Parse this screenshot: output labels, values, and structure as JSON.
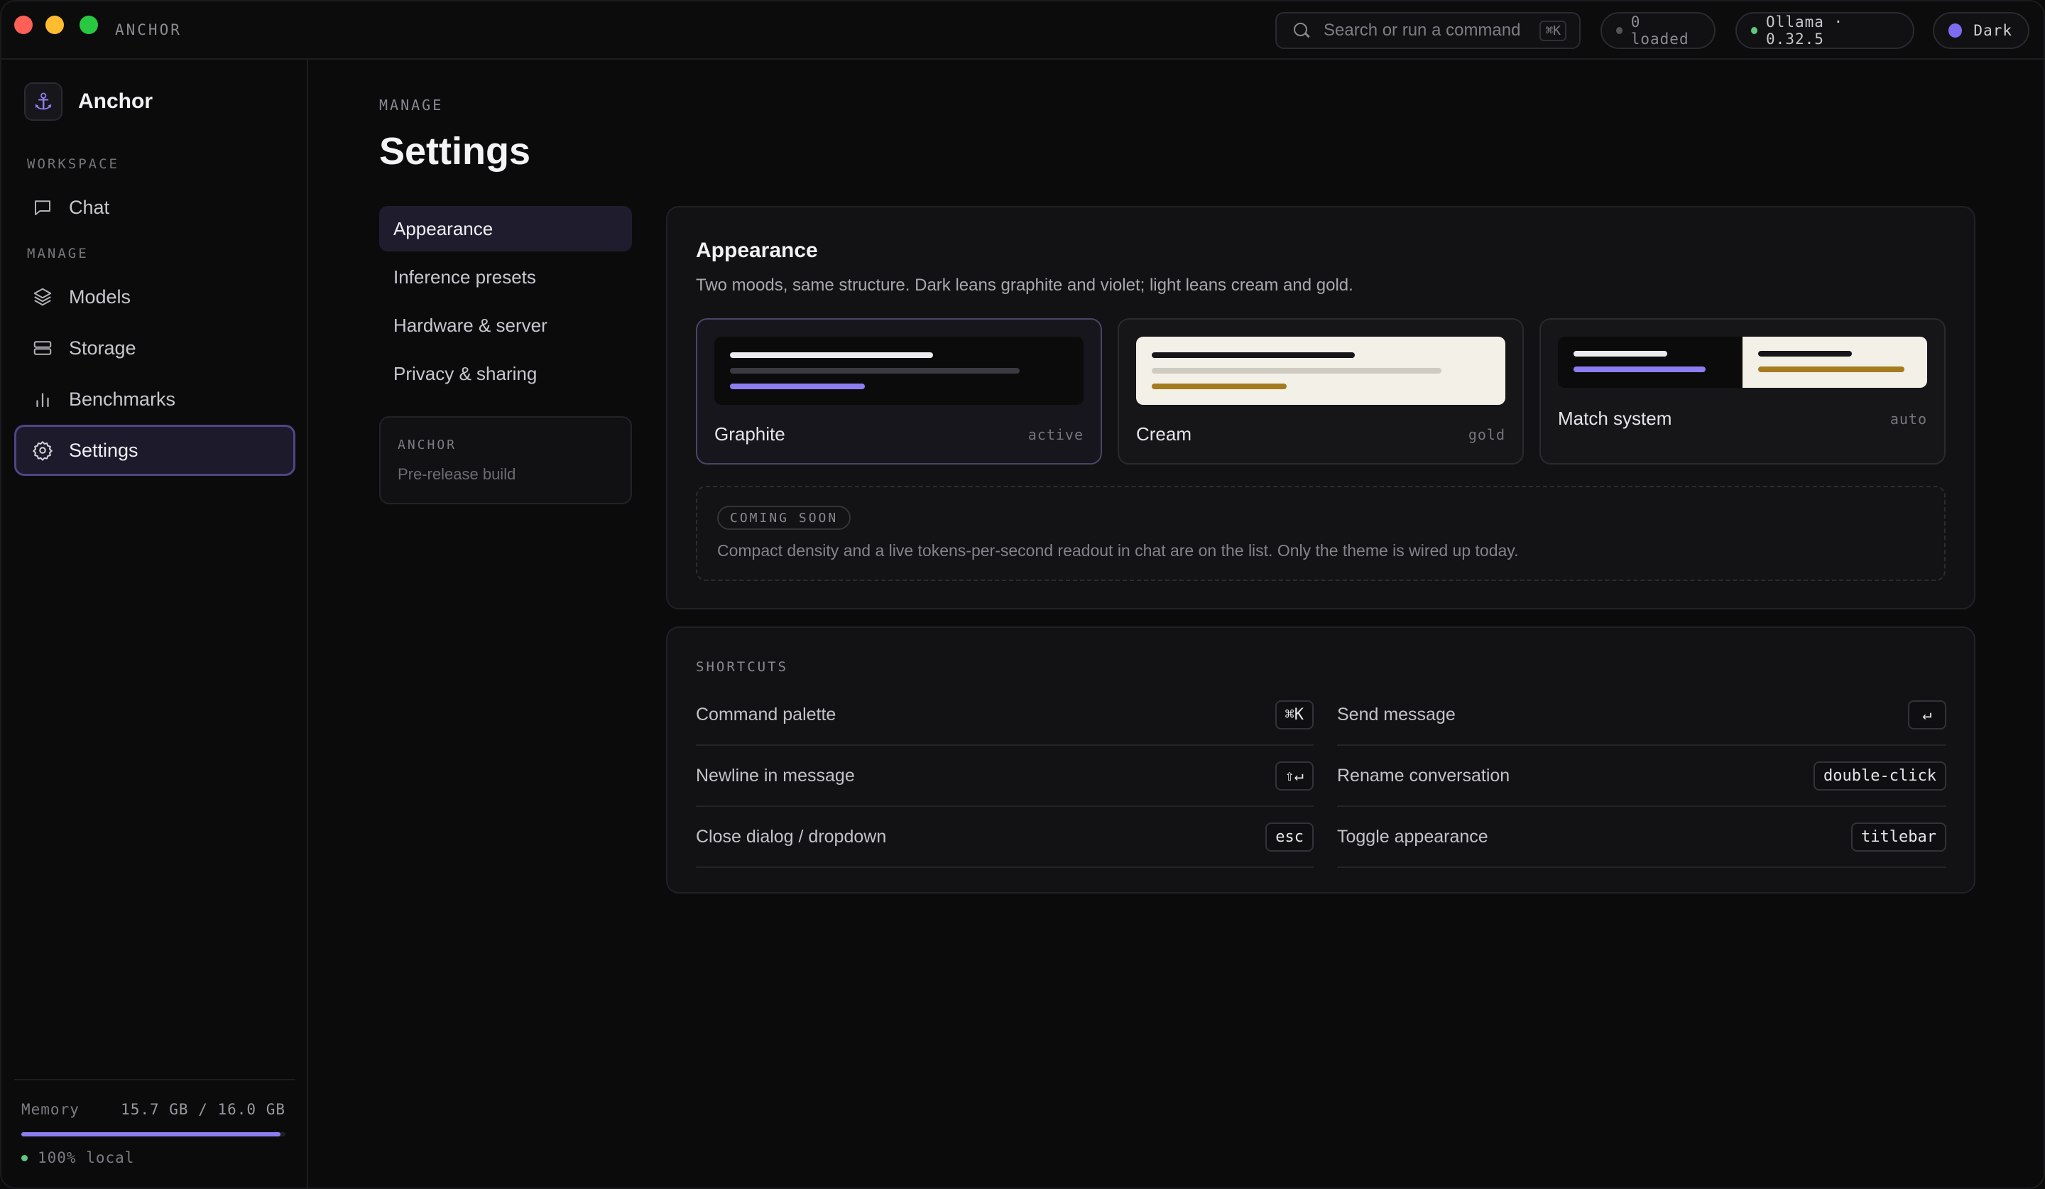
{
  "titlebar": {
    "app_name": "ANCHOR",
    "search": {
      "placeholder": "Search or run a command",
      "shortcut": "⌘K"
    },
    "loaded": "0 loaded",
    "engine": "Ollama · 0.32.5",
    "theme": "Dark"
  },
  "sidebar": {
    "brand": "Anchor",
    "brand_icon": "⚓",
    "sections": {
      "workspace": "WORKSPACE",
      "manage": "MANAGE"
    },
    "items": [
      {
        "label": "Chat",
        "icon": "chat-icon"
      },
      {
        "label": "Models",
        "icon": "layers-icon"
      },
      {
        "label": "Storage",
        "icon": "storage-icon"
      },
      {
        "label": "Benchmarks",
        "icon": "bar-chart-icon"
      },
      {
        "label": "Settings",
        "icon": "gear-icon",
        "active": true
      }
    ],
    "memory": {
      "label": "Memory",
      "value": "15.7 GB / 16.0 GB",
      "fraction": 0.98
    },
    "local": "100% local"
  },
  "main": {
    "breadcrumb": "MANAGE",
    "title": "Settings",
    "subnav": [
      {
        "label": "Appearance",
        "active": true
      },
      {
        "label": "Inference presets"
      },
      {
        "label": "Hardware & server"
      },
      {
        "label": "Privacy & sharing"
      }
    ],
    "build_box": {
      "title": "ANCHOR",
      "subtitle": "Pre-release build"
    },
    "appearance": {
      "title": "Appearance",
      "description": "Two moods, same structure. Dark leans graphite and violet; light leans cream and gold.",
      "themes": [
        {
          "name": "Graphite",
          "tag": "active"
        },
        {
          "name": "Cream",
          "tag": "gold"
        },
        {
          "name": "Match system",
          "tag": "auto"
        }
      ],
      "coming_soon": {
        "badge": "COMING SOON",
        "text": "Compact density and a live tokens-per-second readout in chat are on the list. Only the theme is wired up today."
      }
    },
    "shortcuts": {
      "title": "SHORTCUTS",
      "items": [
        {
          "label": "Command palette",
          "key": "⌘K"
        },
        {
          "label": "Send message",
          "key": "↵"
        },
        {
          "label": "Newline in message",
          "key": "⇧↵"
        },
        {
          "label": "Rename conversation",
          "key": "double-click"
        },
        {
          "label": "Close dialog / dropdown",
          "key": "esc"
        },
        {
          "label": "Toggle appearance",
          "key": "titlebar"
        }
      ]
    }
  },
  "colors": {
    "accent": "#8c7ef2",
    "gold": "#a47b1f",
    "cream": "#f3f0e8",
    "graphite": "#0b0b0c",
    "status_green": "#5fc77f"
  }
}
